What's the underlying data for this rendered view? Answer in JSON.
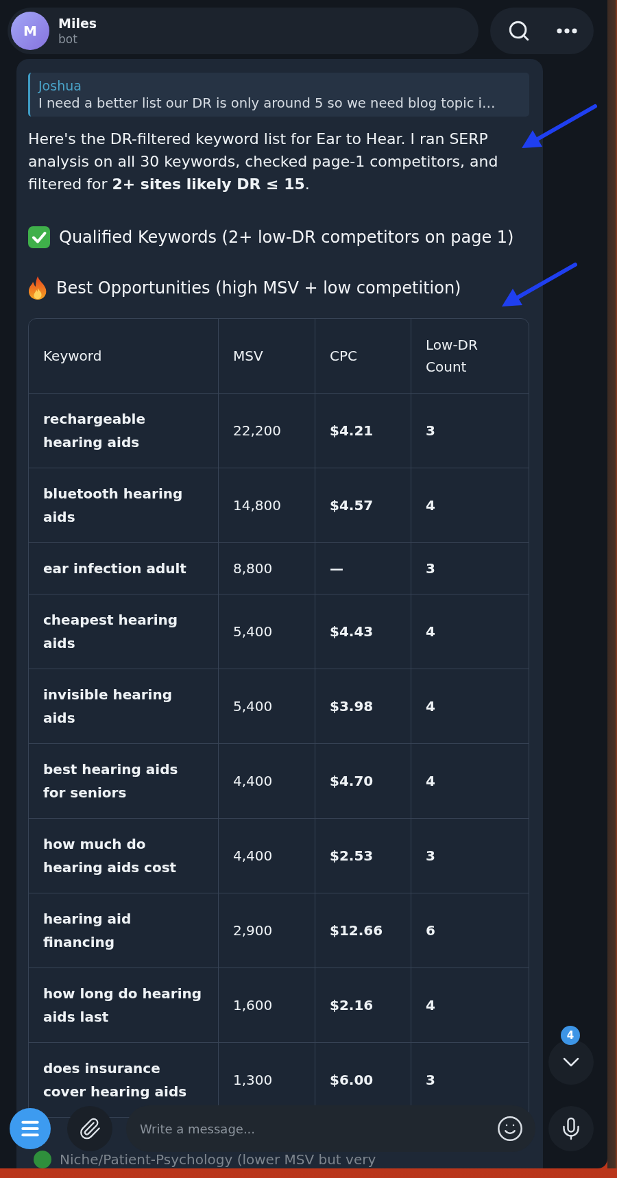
{
  "header": {
    "avatar_letter": "M",
    "name": "Miles",
    "status": "bot"
  },
  "message": {
    "reply": {
      "author": "Joshua",
      "text": "I need a better list our DR is only around 5 so we need blog topic i…"
    },
    "intro": "Here's the DR-filtered keyword list for Ear to Hear. I ran SERP analysis on all 30 keywords, checked page-1 competitors, and filtered for **2+ sites likely DR ≤ 15**.",
    "qualified_heading": "Qualified Keywords (2+ low-DR competitors on page 1)",
    "opportunities_heading": "Best Opportunities (high MSV + low competition)",
    "table": {
      "columns": [
        "Keyword",
        "MSV",
        "CPC",
        "Low-DR Count"
      ],
      "rows": [
        {
          "keyword": "rechargeable hearing aids",
          "msv": "22,200",
          "cpc": "$4.21",
          "low_dr_count": "3"
        },
        {
          "keyword": "bluetooth hearing aids",
          "msv": "14,800",
          "cpc": "$4.57",
          "low_dr_count": "4"
        },
        {
          "keyword": "ear infection adult",
          "msv": "8,800",
          "cpc": "—",
          "low_dr_count": "3"
        },
        {
          "keyword": "cheapest hearing aids",
          "msv": "5,400",
          "cpc": "$4.43",
          "low_dr_count": "4"
        },
        {
          "keyword": "invisible hearing aids",
          "msv": "5,400",
          "cpc": "$3.98",
          "low_dr_count": "4"
        },
        {
          "keyword": "best hearing aids for seniors",
          "msv": "4,400",
          "cpc": "$4.70",
          "low_dr_count": "4"
        },
        {
          "keyword": "how much do hearing aids cost",
          "msv": "4,400",
          "cpc": "$2.53",
          "low_dr_count": "3"
        },
        {
          "keyword": "hearing aid financing",
          "msv": "2,900",
          "cpc": "$12.66",
          "low_dr_count": "6"
        },
        {
          "keyword": "how long do hearing aids last",
          "msv": "1,600",
          "cpc": "$2.16",
          "low_dr_count": "4"
        },
        {
          "keyword": "does insurance cover hearing aids",
          "msv": "1,300",
          "cpc": "$6.00",
          "low_dr_count": "3"
        }
      ]
    },
    "next_heading": "Niche/Patient-Psychology (lower MSV but very"
  },
  "scroll_down": {
    "badge": "4"
  },
  "composer": {
    "placeholder": "Write a message..."
  }
}
